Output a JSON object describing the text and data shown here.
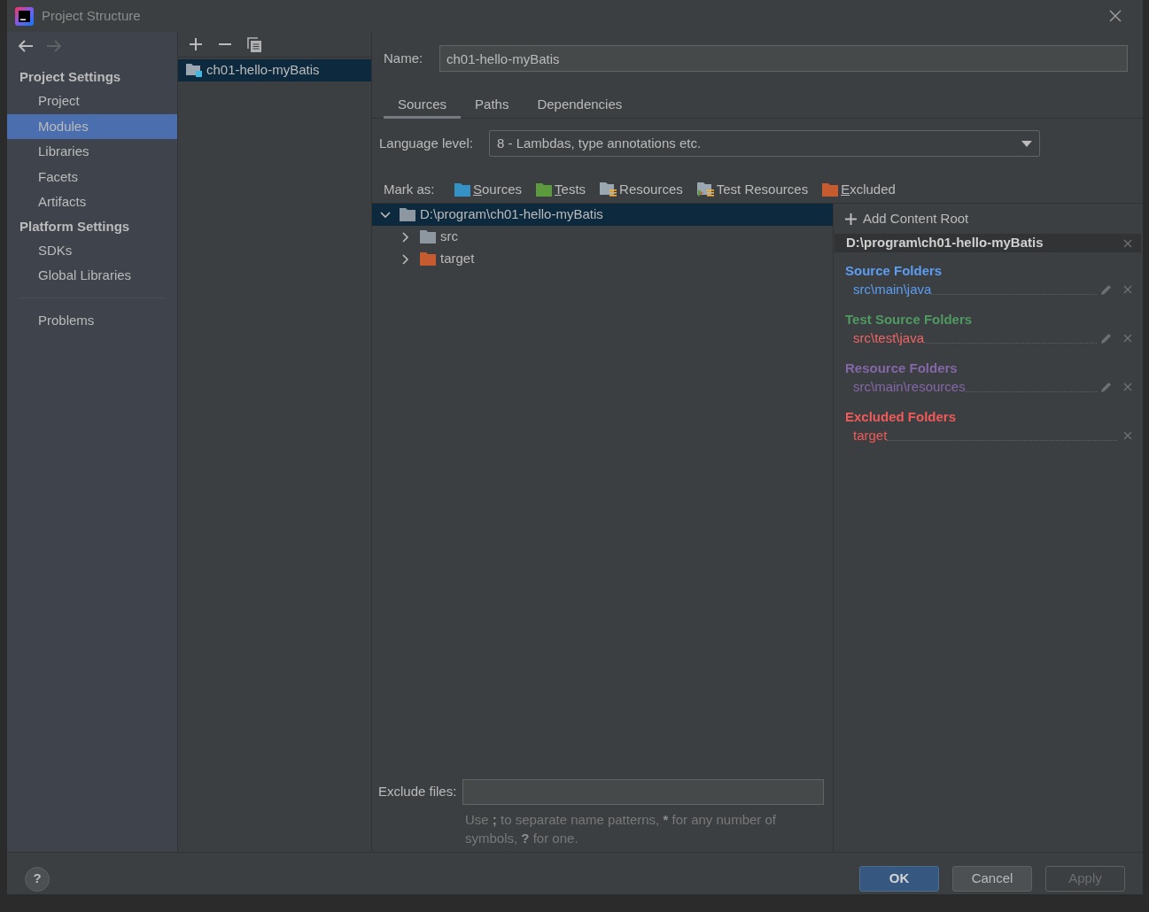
{
  "window": {
    "title": "Project Structure"
  },
  "nav_buttons": [
    {
      "kind": "back",
      "disabled": false
    },
    {
      "kind": "forward",
      "disabled": true
    }
  ],
  "sidebar": {
    "sections": [
      {
        "title": "Project Settings",
        "items": [
          {
            "label": "Project",
            "selected": false
          },
          {
            "label": "Modules",
            "selected": true
          },
          {
            "label": "Libraries",
            "selected": false
          },
          {
            "label": "Facets",
            "selected": false
          },
          {
            "label": "Artifacts",
            "selected": false
          }
        ]
      },
      {
        "title": "Platform Settings",
        "items": [
          {
            "label": "SDKs",
            "selected": false
          },
          {
            "label": "Global Libraries",
            "selected": false
          }
        ]
      }
    ],
    "footer_items": [
      {
        "label": "Problems",
        "selected": false
      }
    ]
  },
  "module_list": {
    "toolbar": [
      {
        "kind": "add"
      },
      {
        "kind": "remove"
      },
      {
        "kind": "copy"
      }
    ],
    "items": [
      {
        "label": "ch01-hello-myBatis",
        "selected": true
      }
    ]
  },
  "module": {
    "name_label": "Name:",
    "name": "ch01-hello-myBatis",
    "tabs": [
      {
        "label": "Sources",
        "selected": true
      },
      {
        "label": "Paths",
        "selected": false
      },
      {
        "label": "Dependencies",
        "selected": false
      }
    ],
    "language_level": {
      "label": "Language level:",
      "value": "8 - Lambdas, type annotations etc."
    },
    "mark_as": {
      "label": "Mark as:",
      "options": [
        {
          "kind": "sources",
          "label": "Sources",
          "underlined_initial": true
        },
        {
          "kind": "tests",
          "label": "Tests",
          "underlined_initial": true
        },
        {
          "kind": "resources",
          "label": "Resources",
          "underlined_initial": false
        },
        {
          "kind": "test_resources",
          "label": "Test Resources",
          "underlined_initial": false
        },
        {
          "kind": "excluded",
          "label": "Excluded",
          "underlined_initial": true
        }
      ]
    },
    "tree": [
      {
        "label": "D:\\program\\ch01-hello-myBatis",
        "kind": "plain",
        "expanded": true,
        "selected": true,
        "children": [
          {
            "label": "src",
            "kind": "plain",
            "expanded": false,
            "selected": false
          },
          {
            "label": "target",
            "kind": "excluded",
            "expanded": false,
            "selected": false
          }
        ]
      }
    ],
    "content_roots": {
      "add_label": "Add Content Root",
      "roots": [
        {
          "path": "D:\\program\\ch01-hello-myBatis",
          "groups": [
            {
              "title": "Source Folders",
              "color": "#5c9df2",
              "entries": [
                {
                  "path": "src\\main\\java",
                  "color": "#5c9df2",
                  "editable": true
                }
              ]
            },
            {
              "title": "Test Source Folders",
              "color": "#4f9a62",
              "entries": [
                {
                  "path": "src\\test\\java",
                  "color": "#f06464",
                  "editable": true
                }
              ]
            },
            {
              "title": "Resource Folders",
              "color": "#8467a8",
              "entries": [
                {
                  "path": "src\\main\\resources",
                  "color": "#8467a8",
                  "editable": true
                }
              ]
            },
            {
              "title": "Excluded Folders",
              "color": "#f25a5a",
              "entries": [
                {
                  "path": "target",
                  "color": "#f25a5a",
                  "editable": false
                }
              ]
            }
          ]
        }
      ]
    },
    "exclude_files": {
      "label": "Exclude files:",
      "hint": [
        {
          "text": "Use ",
          "bold": false
        },
        {
          "text": ";",
          "bold": true
        },
        {
          "text": " to separate name patterns, ",
          "bold": false
        },
        {
          "text": "*",
          "bold": true
        },
        {
          "text": " for any number of symbols, ",
          "bold": false
        },
        {
          "text": "?",
          "bold": true
        },
        {
          "text": " for one.",
          "bold": false
        }
      ]
    }
  },
  "footer": {
    "help": "?",
    "buttons": [
      {
        "label": "OK",
        "default": true,
        "disabled": false
      },
      {
        "label": "Cancel",
        "default": false,
        "disabled": false
      },
      {
        "label": "Apply",
        "default": false,
        "disabled": true
      }
    ]
  }
}
